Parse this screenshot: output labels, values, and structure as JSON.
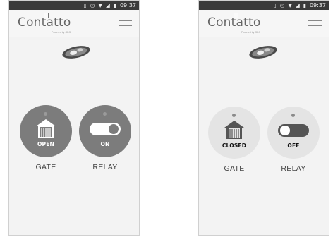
{
  "status_bar": {
    "time": "09:37"
  },
  "logo": {
    "text": "Contatto",
    "tagline": "Powered by GDS"
  },
  "screens": [
    {
      "gate": {
        "state": "OPEN",
        "caption": "GATE"
      },
      "relay": {
        "state": "ON",
        "caption": "RELAY"
      }
    },
    {
      "gate": {
        "state": "CLOSED",
        "caption": "GATE"
      },
      "relay": {
        "state": "OFF",
        "caption": "RELAY"
      }
    }
  ],
  "colors": {
    "active_circle": "#7c7c7c",
    "inactive_circle": "#e4e4e4",
    "status_bar": "#3a3a3a"
  },
  "icons": [
    "vibrate-icon",
    "alarm-icon",
    "wifi-icon",
    "signal-icon",
    "battery-icon",
    "menu-icon",
    "gate-icon",
    "toggle-icon",
    "brand-badge-icon"
  ]
}
